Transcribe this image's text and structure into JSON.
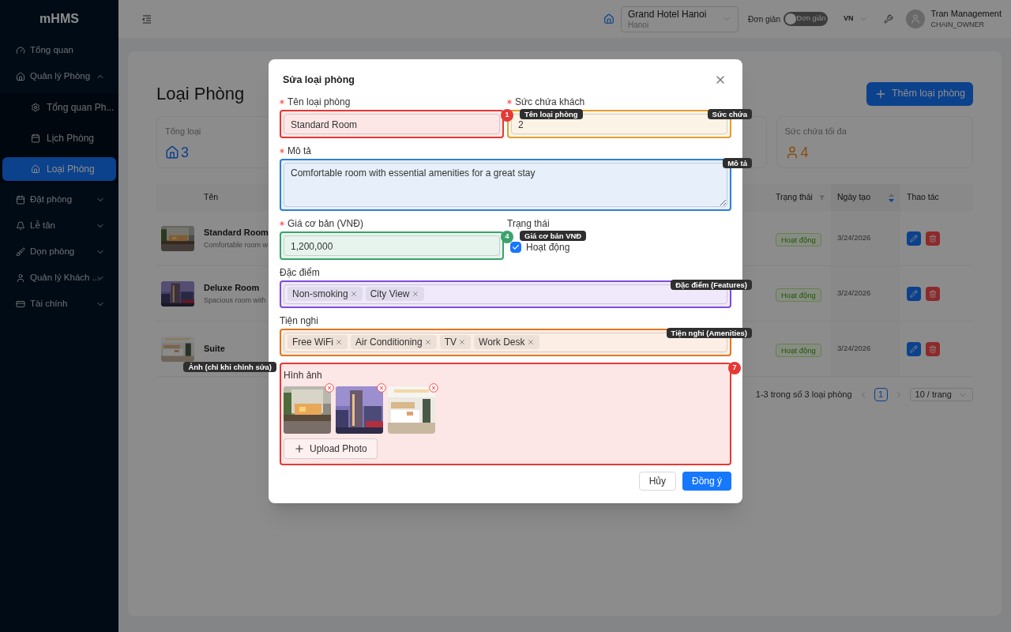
{
  "sidebar": {
    "logo": "mHMS",
    "items": [
      {
        "label": "Tổng quan",
        "selected": false
      },
      {
        "label": "Quản lý Phòng",
        "selected": false,
        "expanded": true,
        "children": [
          {
            "label": "Tổng quan Ph...",
            "selected": false
          },
          {
            "label": "Lịch Phòng",
            "selected": false
          },
          {
            "label": "Loại Phòng",
            "selected": true
          }
        ]
      },
      {
        "label": "Đặt phòng",
        "selected": false,
        "expanded": false
      },
      {
        "label": "Lễ tân",
        "selected": false,
        "expanded": false
      },
      {
        "label": "Dọn phòng",
        "selected": false,
        "expanded": false
      },
      {
        "label": "Quản lý Khách ...",
        "selected": false,
        "expanded": false
      },
      {
        "label": "Tài chính",
        "selected": false,
        "expanded": false
      }
    ]
  },
  "header": {
    "hotel": {
      "name": "Grand Hotel Hanoi",
      "city": "Hanoi"
    },
    "mode_label": "Đơn giản",
    "mode_switch": {
      "on": false,
      "label": "Đơn giản"
    },
    "language": "VN",
    "user": {
      "name": "Tran Management",
      "role": "CHAIN_OWNER"
    }
  },
  "page": {
    "title": "Loại Phòng",
    "add_button": "Thêm loại phòng",
    "stats": [
      {
        "label": "Tổng loại",
        "value": "3"
      },
      {
        "label": "Sức chứa tối đa",
        "value": "4"
      }
    ],
    "table": {
      "columns": [
        {
          "label": "Tên",
          "kind": "plain"
        },
        {
          "label": "Trạng thái",
          "kind": "filter"
        },
        {
          "label": "Ngày tạo",
          "kind": "sort"
        },
        {
          "label": "Thao tác",
          "kind": "plain"
        }
      ],
      "rows": [
        {
          "name": "Standard Room",
          "description": "Comfortable room w",
          "status": "Hoạt động",
          "date": "3/24/2026"
        },
        {
          "name": "Deluxe Room",
          "description": "Spacious room with",
          "status": "Hoạt động",
          "date": "3/24/2026"
        },
        {
          "name": "Suite",
          "status": "Hoạt động",
          "date": "3/24/2026"
        }
      ]
    },
    "pagination": {
      "summary": "1-3 trong số 3 loại phòng",
      "page": "1",
      "page_size": "10 / trang"
    }
  },
  "modal": {
    "title": "Sửa loại phòng",
    "rows": [
      [
        {
          "kind": "input",
          "label": "Tên loại phòng",
          "required": true,
          "value": "Standard Room",
          "color": "#e53935",
          "badge": "1",
          "note": "Tên loại phòng"
        },
        {
          "kind": "input",
          "label": "Sức chứa khách",
          "required": true,
          "value": "2",
          "color": "#e0a030",
          "note": "Sức chứa"
        }
      ],
      [
        {
          "kind": "textarea",
          "label": "Mô tả",
          "required": true,
          "value": "Comfortable room with essential amenities for a great stay",
          "color": "#2f7fd6",
          "note": "Mô tả"
        }
      ],
      [
        {
          "kind": "input",
          "label": "Giá cơ bản (VNĐ)",
          "required": true,
          "value": "1,200,000",
          "color": "#3aa36b",
          "badge": "4",
          "note": "Giá cơ bản VNĐ"
        },
        {
          "kind": "checkbox",
          "label": "Trạng thái",
          "option": "Hoạt động",
          "checked": true
        }
      ],
      [
        {
          "kind": "tags",
          "label": "Đặc điểm",
          "required": false,
          "tags": [
            "Non-smoking",
            "City View"
          ],
          "color": "#7c4dde",
          "note": "Đặc điểm (Features)"
        }
      ],
      [
        {
          "kind": "tags",
          "label": "Tiện nghi",
          "required": false,
          "tags": [
            "Free WiFi",
            "Air Conditioning",
            "TV",
            "Work Desk"
          ],
          "color": "#e5761f",
          "note": "Tiện nghi (Amenities)"
        }
      ],
      [
        {
          "kind": "images",
          "label": "Hình ảnh",
          "color": "#e53935",
          "badge": "7",
          "note": "Ảnh (chỉ khi chỉnh sửa)",
          "upload": "Upload Photo"
        }
      ]
    ],
    "cancel": "Hủy",
    "ok": "Đồng ý"
  }
}
